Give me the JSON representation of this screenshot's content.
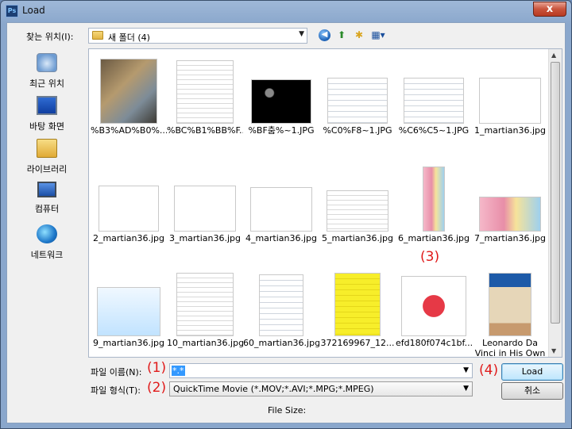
{
  "window": {
    "title": "Load",
    "app_icon": "Ps",
    "close_label": "x"
  },
  "toolbar": {
    "lookin_label": "찾는 위치(I):",
    "lookin_value": "새 폴더 (4)",
    "back_icon": "back-icon",
    "up_icon": "up-folder-icon",
    "newfolder_icon": "new-folder-icon",
    "views_icon": "views-menu-icon"
  },
  "places": [
    {
      "label": "최근 위치",
      "icon": "recent-places-icon"
    },
    {
      "label": "바탕 화면",
      "icon": "desktop-icon"
    },
    {
      "label": "라이브러리",
      "icon": "libraries-icon"
    },
    {
      "label": "컴퓨터",
      "icon": "computer-icon"
    },
    {
      "label": "네트워크",
      "icon": "network-icon"
    }
  ],
  "files": [
    {
      "name": "%B3%AD%B0%...",
      "kind": "photo"
    },
    {
      "name": "%BC%B1%BB%F...",
      "kind": "doc"
    },
    {
      "name": "%BF춤%~1.JPG",
      "kind": "dark"
    },
    {
      "name": "%C0%F8~1.JPG",
      "kind": "sheet"
    },
    {
      "name": "%C6%C5~1.JPG",
      "kind": "sheet"
    },
    {
      "name": "1_martian36.jpg",
      "kind": "math"
    },
    {
      "name": "2_martian36.jpg",
      "kind": "math"
    },
    {
      "name": "3_martian36.jpg",
      "kind": "math"
    },
    {
      "name": "4_martian36.jpg",
      "kind": "math"
    },
    {
      "name": "5_martian36.jpg",
      "kind": "doc"
    },
    {
      "name": "6_martian36.jpg",
      "kind": "color"
    },
    {
      "name": "7_martian36.jpg",
      "kind": "color"
    },
    {
      "name": "9_martian36.jpg",
      "kind": "cartoon"
    },
    {
      "name": "10_martian36.jpg",
      "kind": "doc"
    },
    {
      "name": "60_martian36.jpg",
      "kind": "sheet"
    },
    {
      "name": "372169967_12...",
      "kind": "yellow"
    },
    {
      "name": "efd180f074c1bf...",
      "kind": "mouse"
    },
    {
      "name": "Leonardo Da Vinci in His Own Wor...",
      "kind": "book"
    }
  ],
  "filename": {
    "label": "파일 이름(N):",
    "value": "*.*"
  },
  "filetype": {
    "label": "파일 형식(T):",
    "value": "QuickTime Movie (*.MOV;*.AVI;*.MPG;*.MPEG)"
  },
  "buttons": {
    "load": "Load",
    "cancel": "취소"
  },
  "file_size_label": "File Size:",
  "annotations": {
    "a1": "(1)",
    "a2": "(2)",
    "a3": "(3)",
    "a4": "(4)"
  }
}
